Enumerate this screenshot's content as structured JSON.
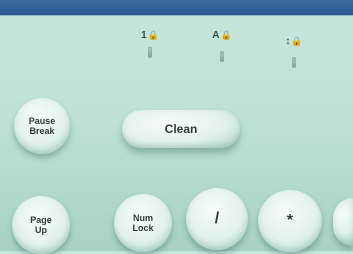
{
  "indicators": [
    {
      "label": "1",
      "icon": "lock-icon"
    },
    {
      "label": "A",
      "icon": "lock-icon"
    },
    {
      "label": "↕",
      "icon": "lock-icon"
    }
  ],
  "keys": {
    "pause_break": {
      "line1": "Pause",
      "line2": "Break"
    },
    "clean": {
      "label": "Clean"
    },
    "page_up": {
      "line1": "Page",
      "line2": "Up"
    },
    "num_lock": {
      "line1": "Num",
      "line2": "Lock"
    },
    "slash": {
      "label": "/"
    },
    "asterisk": {
      "label": "*"
    }
  },
  "colors": {
    "background": "#c2e4d8",
    "top_bar": "#2f5f92",
    "key_face": "#e6f4ef",
    "key_text": "#2c3e3a"
  }
}
